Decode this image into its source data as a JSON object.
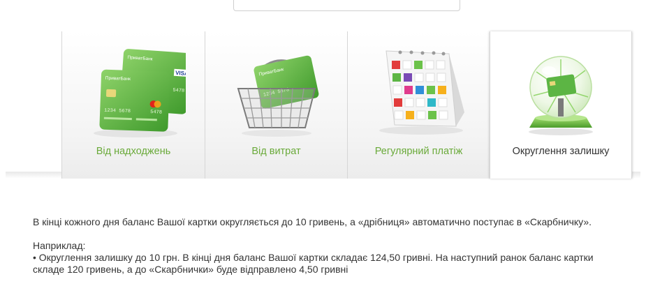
{
  "tabs": [
    {
      "label": "Від надходжень",
      "icon": "green-cards-icon",
      "active": false
    },
    {
      "label": "Від витрат",
      "icon": "shopping-basket-card-icon",
      "active": false
    },
    {
      "label": "Регулярний платіж",
      "icon": "calendar-icon",
      "active": false
    },
    {
      "label": "Округлення залишку",
      "icon": "glass-sphere-card-icon",
      "active": true
    }
  ],
  "card_brand": "ПриватБанк",
  "card_visa": "VISA",
  "card_number_a": "1234 5678",
  "card_number_b": "5478",
  "content": {
    "paragraph1": "В кінці кожного дня баланс Вашої картки округляється до 10 гривень, а «дрібниця» автоматично поступає в «Скарбничку».",
    "example_heading": "Наприклад:",
    "example_line1": "• Округлення залишку до 10 грн. В кінці дня баланс Вашої картки складає 124,50 гривні. На наступний ранок баланс картки",
    "example_line2": "складе 120 гривень, а до «Скарбнички» буде відправлено 4,50 гривні"
  },
  "colors": {
    "accent_green": "#6aaa3a",
    "card_green": "#5cb544",
    "text": "#333333"
  }
}
